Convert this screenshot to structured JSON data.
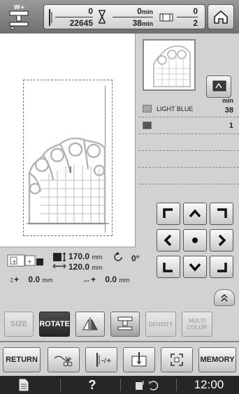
{
  "topbar": {
    "stitch_count": "0",
    "stitch_total": "22645",
    "time_elapsed": "0",
    "time_total": "38",
    "time_unit": "min",
    "color_current": "0",
    "color_total": "2"
  },
  "color_list": {
    "header_unit": "min",
    "rows": [
      {
        "name": "LIGHT BLUE",
        "value": "38",
        "swatch": "#a7a7a7"
      },
      {
        "name": "",
        "value": "1",
        "swatch": "#555555"
      }
    ]
  },
  "info": {
    "width_value": "170.0",
    "width_unit": "mm",
    "height_value": "120.0",
    "height_unit": "mm",
    "angle": "0°",
    "offset_v": "0.0",
    "offset_v_unit": "mm",
    "offset_h": "0.0",
    "offset_h_unit": "mm"
  },
  "edit_row": {
    "size": "SIZE",
    "rotate": "ROTATE",
    "density": "DENSITY",
    "multi_color_line1": "MULTI",
    "multi_color_line2": "COLOR"
  },
  "action_row": {
    "return": "RETURN",
    "memory": "MEMORY"
  },
  "bottom": {
    "help": "?",
    "clock": "12:00"
  },
  "colors": {
    "design_gray": "#b4b4b4",
    "button_dark": "#2b2b2b",
    "bar_dark": "#262626"
  }
}
